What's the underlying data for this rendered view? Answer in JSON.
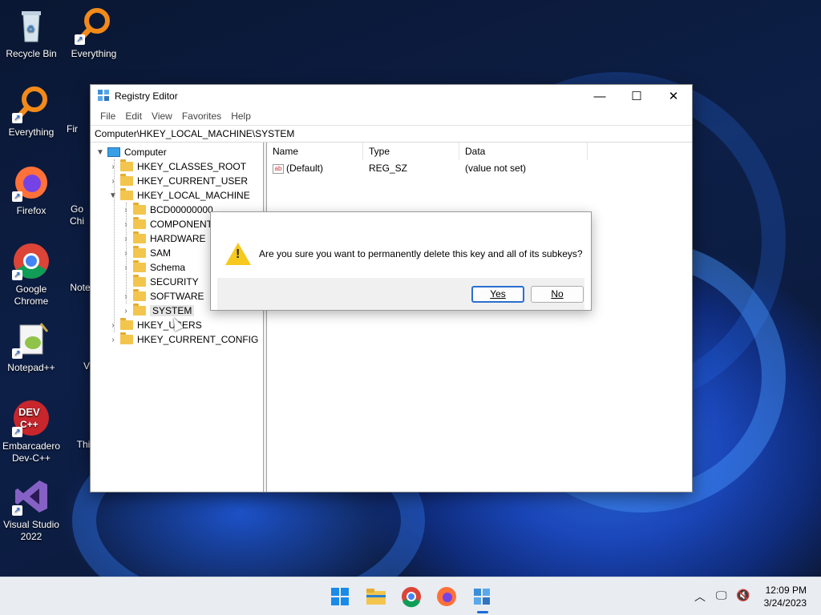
{
  "desktop": {
    "icons": [
      {
        "label": "Recycle Bin",
        "icon": "recycle-bin-icon"
      },
      {
        "label": "Everything",
        "icon": "everything-icon"
      },
      {
        "label": "Everything",
        "icon": "everything-icon"
      },
      {
        "label": "Firefox",
        "icon": "firefox-icon"
      },
      {
        "label": "Google Chrome",
        "icon": "chrome-icon"
      },
      {
        "label": "Notepad++",
        "icon": "notepadpp-icon"
      },
      {
        "label": "Embarcadero Dev-C++",
        "icon": "devcpp-icon"
      },
      {
        "label": "Visual Studio 2022",
        "icon": "visual-studio-icon"
      }
    ],
    "partial_labels": [
      "Fir",
      "Go",
      "Chi",
      "Note",
      "V",
      "Thi"
    ]
  },
  "window": {
    "title": "Registry Editor",
    "controls": {
      "minimize": "—",
      "maximize": "☐",
      "close": "✕"
    },
    "menu": [
      "File",
      "Edit",
      "View",
      "Favorites",
      "Help"
    ],
    "address": "Computer\\HKEY_LOCAL_MACHINE\\SYSTEM",
    "tree": {
      "root": "Computer",
      "hives": [
        "HKEY_CLASSES_ROOT",
        "HKEY_CURRENT_USER",
        "HKEY_LOCAL_MACHINE"
      ],
      "hklm_children": [
        "BCD00000000",
        "COMPONENTS",
        "HARDWARE",
        "SAM",
        "Schema",
        "SECURITY",
        "SOFTWARE",
        "SYSTEM"
      ],
      "other_hives": [
        "HKEY_USERS",
        "HKEY_CURRENT_CONFIG"
      ]
    },
    "list": {
      "columns": [
        "Name",
        "Type",
        "Data"
      ],
      "rows": [
        {
          "name": "(Default)",
          "type": "REG_SZ",
          "data": "(value not set)"
        }
      ]
    }
  },
  "dialog": {
    "message": "Are you sure you want to permanently delete this key and all of its subkeys?",
    "yes_label": "Yes",
    "no_label": "No"
  },
  "taskbar": {
    "time": "12:09 PM",
    "date": "3/24/2023"
  }
}
